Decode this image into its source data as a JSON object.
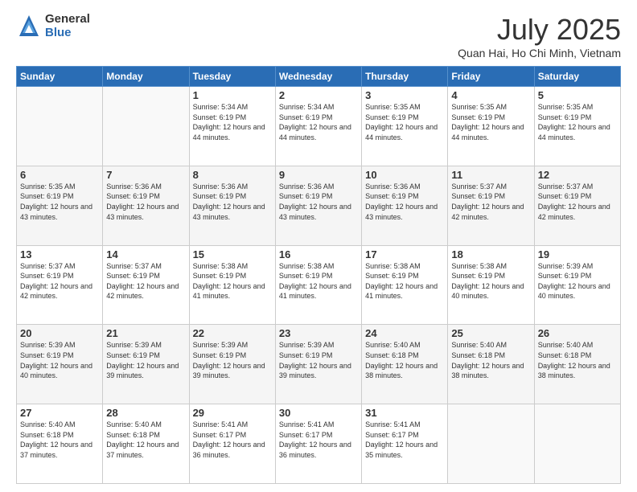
{
  "logo": {
    "general": "General",
    "blue": "Blue"
  },
  "title": "July 2025",
  "location": "Quan Hai, Ho Chi Minh, Vietnam",
  "days_of_week": [
    "Sunday",
    "Monday",
    "Tuesday",
    "Wednesday",
    "Thursday",
    "Friday",
    "Saturday"
  ],
  "weeks": [
    [
      {
        "day": "",
        "sunrise": "",
        "sunset": "",
        "daylight": "",
        "empty": true
      },
      {
        "day": "",
        "sunrise": "",
        "sunset": "",
        "daylight": "",
        "empty": true
      },
      {
        "day": "1",
        "sunrise": "Sunrise: 5:34 AM",
        "sunset": "Sunset: 6:19 PM",
        "daylight": "Daylight: 12 hours and 44 minutes."
      },
      {
        "day": "2",
        "sunrise": "Sunrise: 5:34 AM",
        "sunset": "Sunset: 6:19 PM",
        "daylight": "Daylight: 12 hours and 44 minutes."
      },
      {
        "day": "3",
        "sunrise": "Sunrise: 5:35 AM",
        "sunset": "Sunset: 6:19 PM",
        "daylight": "Daylight: 12 hours and 44 minutes."
      },
      {
        "day": "4",
        "sunrise": "Sunrise: 5:35 AM",
        "sunset": "Sunset: 6:19 PM",
        "daylight": "Daylight: 12 hours and 44 minutes."
      },
      {
        "day": "5",
        "sunrise": "Sunrise: 5:35 AM",
        "sunset": "Sunset: 6:19 PM",
        "daylight": "Daylight: 12 hours and 44 minutes."
      }
    ],
    [
      {
        "day": "6",
        "sunrise": "Sunrise: 5:35 AM",
        "sunset": "Sunset: 6:19 PM",
        "daylight": "Daylight: 12 hours and 43 minutes."
      },
      {
        "day": "7",
        "sunrise": "Sunrise: 5:36 AM",
        "sunset": "Sunset: 6:19 PM",
        "daylight": "Daylight: 12 hours and 43 minutes."
      },
      {
        "day": "8",
        "sunrise": "Sunrise: 5:36 AM",
        "sunset": "Sunset: 6:19 PM",
        "daylight": "Daylight: 12 hours and 43 minutes."
      },
      {
        "day": "9",
        "sunrise": "Sunrise: 5:36 AM",
        "sunset": "Sunset: 6:19 PM",
        "daylight": "Daylight: 12 hours and 43 minutes."
      },
      {
        "day": "10",
        "sunrise": "Sunrise: 5:36 AM",
        "sunset": "Sunset: 6:19 PM",
        "daylight": "Daylight: 12 hours and 43 minutes."
      },
      {
        "day": "11",
        "sunrise": "Sunrise: 5:37 AM",
        "sunset": "Sunset: 6:19 PM",
        "daylight": "Daylight: 12 hours and 42 minutes."
      },
      {
        "day": "12",
        "sunrise": "Sunrise: 5:37 AM",
        "sunset": "Sunset: 6:19 PM",
        "daylight": "Daylight: 12 hours and 42 minutes."
      }
    ],
    [
      {
        "day": "13",
        "sunrise": "Sunrise: 5:37 AM",
        "sunset": "Sunset: 6:19 PM",
        "daylight": "Daylight: 12 hours and 42 minutes."
      },
      {
        "day": "14",
        "sunrise": "Sunrise: 5:37 AM",
        "sunset": "Sunset: 6:19 PM",
        "daylight": "Daylight: 12 hours and 42 minutes."
      },
      {
        "day": "15",
        "sunrise": "Sunrise: 5:38 AM",
        "sunset": "Sunset: 6:19 PM",
        "daylight": "Daylight: 12 hours and 41 minutes."
      },
      {
        "day": "16",
        "sunrise": "Sunrise: 5:38 AM",
        "sunset": "Sunset: 6:19 PM",
        "daylight": "Daylight: 12 hours and 41 minutes."
      },
      {
        "day": "17",
        "sunrise": "Sunrise: 5:38 AM",
        "sunset": "Sunset: 6:19 PM",
        "daylight": "Daylight: 12 hours and 41 minutes."
      },
      {
        "day": "18",
        "sunrise": "Sunrise: 5:38 AM",
        "sunset": "Sunset: 6:19 PM",
        "daylight": "Daylight: 12 hours and 40 minutes."
      },
      {
        "day": "19",
        "sunrise": "Sunrise: 5:39 AM",
        "sunset": "Sunset: 6:19 PM",
        "daylight": "Daylight: 12 hours and 40 minutes."
      }
    ],
    [
      {
        "day": "20",
        "sunrise": "Sunrise: 5:39 AM",
        "sunset": "Sunset: 6:19 PM",
        "daylight": "Daylight: 12 hours and 40 minutes."
      },
      {
        "day": "21",
        "sunrise": "Sunrise: 5:39 AM",
        "sunset": "Sunset: 6:19 PM",
        "daylight": "Daylight: 12 hours and 39 minutes."
      },
      {
        "day": "22",
        "sunrise": "Sunrise: 5:39 AM",
        "sunset": "Sunset: 6:19 PM",
        "daylight": "Daylight: 12 hours and 39 minutes."
      },
      {
        "day": "23",
        "sunrise": "Sunrise: 5:39 AM",
        "sunset": "Sunset: 6:19 PM",
        "daylight": "Daylight: 12 hours and 39 minutes."
      },
      {
        "day": "24",
        "sunrise": "Sunrise: 5:40 AM",
        "sunset": "Sunset: 6:18 PM",
        "daylight": "Daylight: 12 hours and 38 minutes."
      },
      {
        "day": "25",
        "sunrise": "Sunrise: 5:40 AM",
        "sunset": "Sunset: 6:18 PM",
        "daylight": "Daylight: 12 hours and 38 minutes."
      },
      {
        "day": "26",
        "sunrise": "Sunrise: 5:40 AM",
        "sunset": "Sunset: 6:18 PM",
        "daylight": "Daylight: 12 hours and 38 minutes."
      }
    ],
    [
      {
        "day": "27",
        "sunrise": "Sunrise: 5:40 AM",
        "sunset": "Sunset: 6:18 PM",
        "daylight": "Daylight: 12 hours and 37 minutes."
      },
      {
        "day": "28",
        "sunrise": "Sunrise: 5:40 AM",
        "sunset": "Sunset: 6:18 PM",
        "daylight": "Daylight: 12 hours and 37 minutes."
      },
      {
        "day": "29",
        "sunrise": "Sunrise: 5:41 AM",
        "sunset": "Sunset: 6:17 PM",
        "daylight": "Daylight: 12 hours and 36 minutes."
      },
      {
        "day": "30",
        "sunrise": "Sunrise: 5:41 AM",
        "sunset": "Sunset: 6:17 PM",
        "daylight": "Daylight: 12 hours and 36 minutes."
      },
      {
        "day": "31",
        "sunrise": "Sunrise: 5:41 AM",
        "sunset": "Sunset: 6:17 PM",
        "daylight": "Daylight: 12 hours and 35 minutes."
      },
      {
        "day": "",
        "sunrise": "",
        "sunset": "",
        "daylight": "",
        "empty": true
      },
      {
        "day": "",
        "sunrise": "",
        "sunset": "",
        "daylight": "",
        "empty": true
      }
    ]
  ]
}
